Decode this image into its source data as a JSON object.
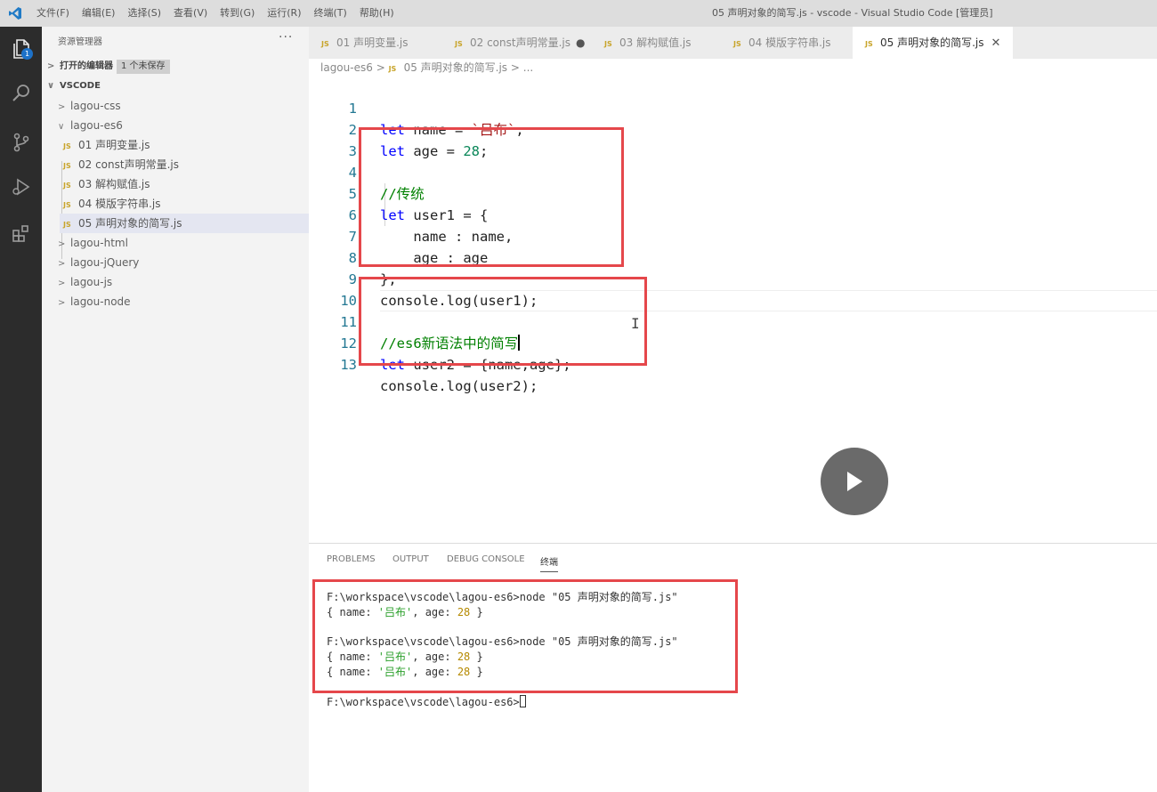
{
  "titlebar": {
    "menus": [
      "文件(F)",
      "编辑(E)",
      "选择(S)",
      "查看(V)",
      "转到(G)",
      "运行(R)",
      "终端(T)",
      "帮助(H)"
    ],
    "window_title": "05 声明对象的简写.js - vscode - Visual Studio Code [管理员]"
  },
  "activity": {
    "explorer_badge": "1"
  },
  "sidebar": {
    "title": "资源管理器",
    "more": "···",
    "open_editors": "打开的编辑器",
    "unsaved": "1 个未保存",
    "workspace": "VSCODE",
    "folders_top": [
      "lagou-css"
    ],
    "open_folder": "lagou-es6",
    "files": [
      {
        "icon": "JS",
        "name": "01 声明变量.js"
      },
      {
        "icon": "JS",
        "name": "02 const声明常量.js"
      },
      {
        "icon": "JS",
        "name": "03 解构赋值.js"
      },
      {
        "icon": "JS",
        "name": "04 模版字符串.js"
      },
      {
        "icon": "JS",
        "name": "05 声明对象的简写.js"
      }
    ],
    "folders_bottom": [
      "lagou-html",
      "lagou-jQuery",
      "lagou-js",
      "lagou-node"
    ]
  },
  "tabs": [
    {
      "icon": "JS",
      "label": "01 声明变量.js"
    },
    {
      "icon": "JS",
      "label": "02 const声明常量.js",
      "dirty": "●"
    },
    {
      "icon": "JS",
      "label": "03 解构赋值.js"
    },
    {
      "icon": "JS",
      "label": "04 模版字符串.js"
    },
    {
      "icon": "JS",
      "label": "05 声明对象的简写.js",
      "close": "✕"
    }
  ],
  "breadcrumb": {
    "folder": "lagou-es6",
    "sep": ">",
    "icon": "JS",
    "file": "05 声明对象的简写.js",
    "tail": "> ..."
  },
  "editor": {
    "line_numbers": [
      "1",
      "2",
      "3",
      "4",
      "5",
      "6",
      "7",
      "8",
      "9",
      "10",
      "11",
      "12",
      "13"
    ],
    "l1": {
      "kw": "let",
      "a": " name = ",
      "str": "`吕布`",
      "b": ";"
    },
    "l2": {
      "kw": "let",
      "a": " age = ",
      "num": "28",
      "b": ";"
    },
    "l4": {
      "cmt": "//传统"
    },
    "l5": {
      "kw": "let",
      "a": " user1 = {"
    },
    "l6": {
      "a": "    name : name,"
    },
    "l7": {
      "a": "    age : age"
    },
    "l8": {
      "a": "};"
    },
    "l9": {
      "a": "console.log(user1);"
    },
    "l11": {
      "cmt": "//es6新语法中的简写"
    },
    "l12": {
      "kw": "let",
      "a": " user2 = {name,age};"
    },
    "l13": {
      "a": "console.log(user2);"
    },
    "ibeam": "I"
  },
  "panel": {
    "tabs": [
      "PROBLEMS",
      "OUTPUT",
      "DEBUG CONSOLE",
      "终端"
    ],
    "cmd": "F:\\workspace\\vscode\\lagou-es6>node \"05 声明对象的简写.js\"",
    "out_a": "{ name: ",
    "out_str": "'吕布'",
    "out_b": ", age: ",
    "out_num": "28",
    "out_c": " }",
    "prompt": "F:\\workspace\\vscode\\lagou-es6>"
  },
  "colors": {
    "highlight_box": "#e5474b",
    "activity_bar": "#2c2c2c",
    "accent": "#1d72c9"
  }
}
